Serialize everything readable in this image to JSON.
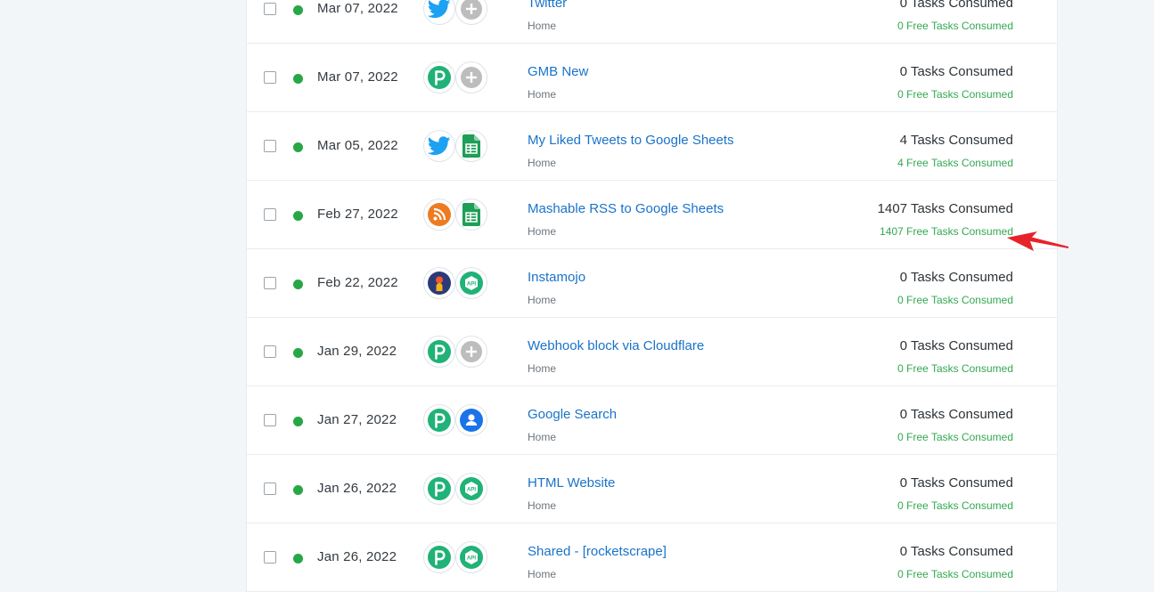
{
  "colors": {
    "link": "#1a73c9",
    "status_active": "#27a745",
    "free_tasks": "#34a853",
    "annotation_arrow": "#e8222a"
  },
  "workflows": [
    {
      "date": "Mar 07, 2022",
      "name": "Twitter",
      "folder": "Home",
      "tasks": "0 Tasks Consumed",
      "free_tasks": "0 Free Tasks Consumed",
      "icons": [
        "twitter-icon",
        "add-action-icon"
      ]
    },
    {
      "date": "Mar 07, 2022",
      "name": "GMB New",
      "folder": "Home",
      "tasks": "0 Tasks Consumed",
      "free_tasks": "0 Free Tasks Consumed",
      "icons": [
        "pabbly-icon",
        "add-action-icon"
      ]
    },
    {
      "date": "Mar 05, 2022",
      "name": "My Liked Tweets to Google Sheets",
      "folder": "Home",
      "tasks": "4 Tasks Consumed",
      "free_tasks": "4 Free Tasks Consumed",
      "icons": [
        "twitter-icon",
        "google-sheets-icon"
      ]
    },
    {
      "date": "Feb 27, 2022",
      "name": "Mashable RSS to Google Sheets",
      "folder": "Home",
      "tasks": "1407 Tasks Consumed",
      "free_tasks": "1407 Free Tasks Consumed",
      "icons": [
        "rss-icon",
        "google-sheets-icon"
      ]
    },
    {
      "date": "Feb 22, 2022",
      "name": "Instamojo",
      "folder": "Home",
      "tasks": "0 Tasks Consumed",
      "free_tasks": "0 Free Tasks Consumed",
      "icons": [
        "instamojo-icon",
        "api-icon"
      ]
    },
    {
      "date": "Jan 29, 2022",
      "name": "Webhook block via Cloudflare",
      "folder": "Home",
      "tasks": "0 Tasks Consumed",
      "free_tasks": "0 Free Tasks Consumed",
      "icons": [
        "pabbly-icon",
        "add-action-icon"
      ]
    },
    {
      "date": "Jan 27, 2022",
      "name": "Google Search",
      "folder": "Home",
      "tasks": "0 Tasks Consumed",
      "free_tasks": "0 Free Tasks Consumed",
      "icons": [
        "pabbly-icon",
        "user-icon"
      ]
    },
    {
      "date": "Jan 26, 2022",
      "name": "HTML Website",
      "folder": "Home",
      "tasks": "0 Tasks Consumed",
      "free_tasks": "0 Free Tasks Consumed",
      "icons": [
        "pabbly-icon",
        "api-icon"
      ]
    },
    {
      "date": "Jan 26, 2022",
      "name": "Shared - [rocketscrape]",
      "folder": "Home",
      "tasks": "0 Tasks Consumed",
      "free_tasks": "0 Free Tasks Consumed",
      "icons": [
        "pabbly-icon",
        "api-icon"
      ]
    }
  ]
}
